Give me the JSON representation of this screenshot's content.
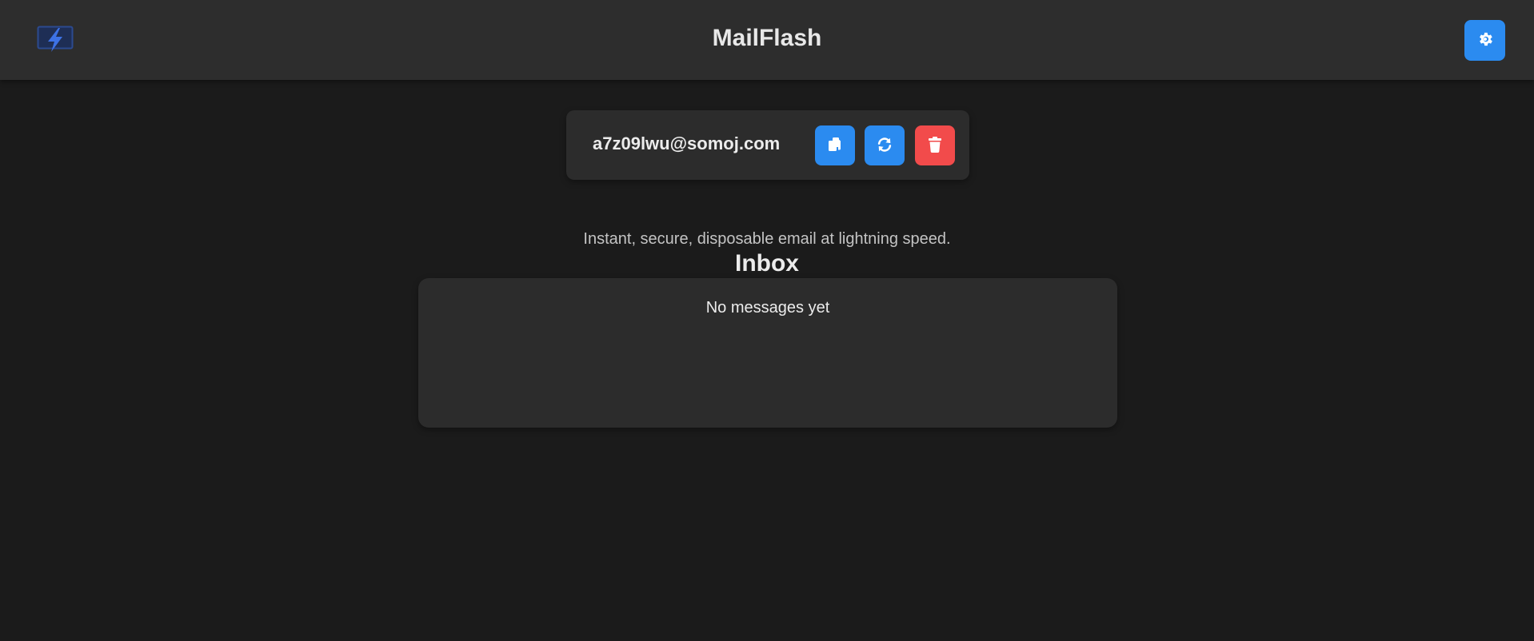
{
  "header": {
    "title": "MailFlash",
    "logo_icon": "lightning-bolt-icon",
    "settings_icon": "gear-icon"
  },
  "email": {
    "address": "a7z09lwu@somoj.com",
    "copy_icon": "copy-icon",
    "refresh_icon": "refresh-icon",
    "delete_icon": "trash-icon"
  },
  "tagline": "Instant, secure, disposable email at lightning speed.",
  "inbox": {
    "title": "Inbox",
    "empty_message": "No messages yet"
  },
  "colors": {
    "background": "#1b1b1b",
    "header": "#2d2d2d",
    "card": "#2c2c2c",
    "accent": "#2b8bf0",
    "danger": "#f24b4b",
    "logo": "#2f5fc9"
  }
}
